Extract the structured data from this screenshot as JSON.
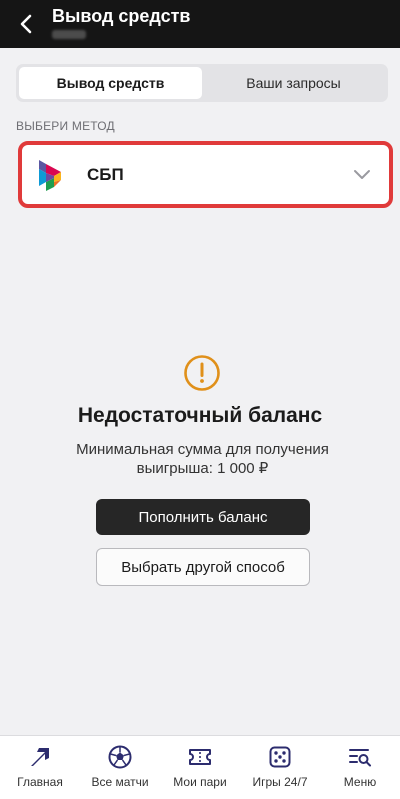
{
  "header": {
    "title": "Вывод средств"
  },
  "tabs": [
    {
      "label": "Вывод средств",
      "active": true
    },
    {
      "label": "Ваши запросы",
      "active": false
    }
  ],
  "method": {
    "section_label": "ВЫБЕРИ МЕТОД",
    "selected": "СБП",
    "icon": "sbp-logo"
  },
  "warning": {
    "icon": "exclamation-circle-icon",
    "title": "Недостаточный баланс",
    "text": "Минимальная сумма для получения выигрыша: 1 000 ₽"
  },
  "actions": {
    "primary_label": "Пополнить баланс",
    "secondary_label": "Выбрать другой способ"
  },
  "bottom_nav": [
    {
      "label": "Главная",
      "icon": "home-arrow-icon"
    },
    {
      "label": "Все матчи",
      "icon": "soccer-ball-icon"
    },
    {
      "label": "Мои пари",
      "icon": "ticket-icon"
    },
    {
      "label": "Игры 24/7",
      "icon": "dice-icon"
    },
    {
      "label": "Меню",
      "icon": "menu-search-icon"
    }
  ],
  "colors": {
    "header_bg": "#151515",
    "highlight_border": "#e03a3a",
    "warning_accent": "#e0901a",
    "primary_button": "#262626"
  }
}
